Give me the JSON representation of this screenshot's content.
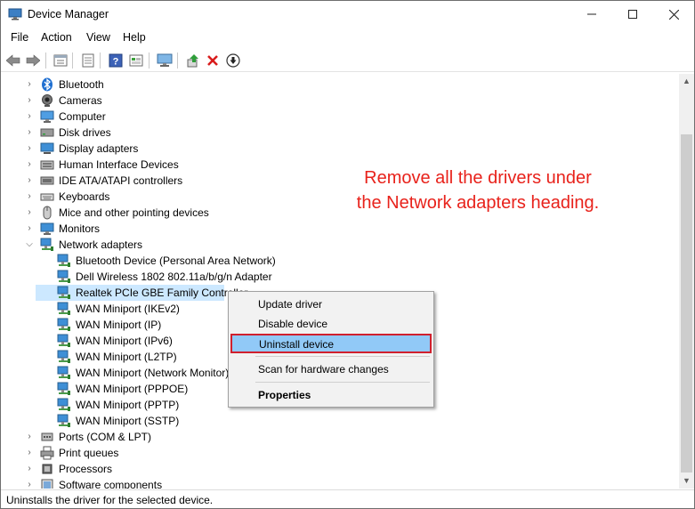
{
  "window": {
    "title": "Device Manager"
  },
  "menu": [
    "File",
    "Action",
    "View",
    "Help"
  ],
  "toolbar": [
    "back-icon",
    "forward-icon",
    "properties-icon",
    "update-driver-icon",
    "help-icon",
    "show-hidden-icon",
    "computer-icon",
    "enable-device-icon",
    "uninstall-icon",
    "download-icon"
  ],
  "tree": {
    "categories_top": [
      {
        "label": "Bluetooth",
        "icon": "bluetooth-icon"
      },
      {
        "label": "Cameras",
        "icon": "camera-icon"
      },
      {
        "label": "Computer",
        "icon": "computer-icon"
      },
      {
        "label": "Disk drives",
        "icon": "disk-icon"
      },
      {
        "label": "Display adapters",
        "icon": "display-icon"
      },
      {
        "label": "Human Interface Devices",
        "icon": "hid-icon"
      },
      {
        "label": "IDE ATA/ATAPI controllers",
        "icon": "ide-icon"
      },
      {
        "label": "Keyboards",
        "icon": "keyboard-icon"
      },
      {
        "label": "Mice and other pointing devices",
        "icon": "mouse-icon"
      },
      {
        "label": "Monitors",
        "icon": "monitor-icon"
      }
    ],
    "network": {
      "label": "Network adapters",
      "children": [
        "Bluetooth Device (Personal Area Network)",
        "Dell Wireless 1802 802.11a/b/g/n Adapter",
        "Realtek PCIe GBE Family Controller",
        "WAN Miniport (IKEv2)",
        "WAN Miniport (IP)",
        "WAN Miniport (IPv6)",
        "WAN Miniport (L2TP)",
        "WAN Miniport (Network Monitor)",
        "WAN Miniport (PPPOE)",
        "WAN Miniport (PPTP)",
        "WAN Miniport (SSTP)"
      ]
    },
    "categories_bottom": [
      {
        "label": "Ports (COM & LPT)",
        "icon": "port-icon"
      },
      {
        "label": "Print queues",
        "icon": "printer-icon"
      },
      {
        "label": "Processors",
        "icon": "processor-icon"
      },
      {
        "label": "Software components",
        "icon": "software-icon"
      }
    ]
  },
  "context_menu": {
    "update": "Update driver",
    "disable": "Disable device",
    "uninstall": "Uninstall device",
    "scan": "Scan for hardware changes",
    "properties": "Properties"
  },
  "annotation": {
    "line1": "Remove all the drivers under",
    "line2": "the Network adapters heading."
  },
  "status": "Uninstalls the driver for the selected device.",
  "colors": {
    "annotation": "#e8221b",
    "selection": "#cce8ff",
    "menu_highlight": "#91c9f7",
    "highlight_border": "#d0202e"
  }
}
